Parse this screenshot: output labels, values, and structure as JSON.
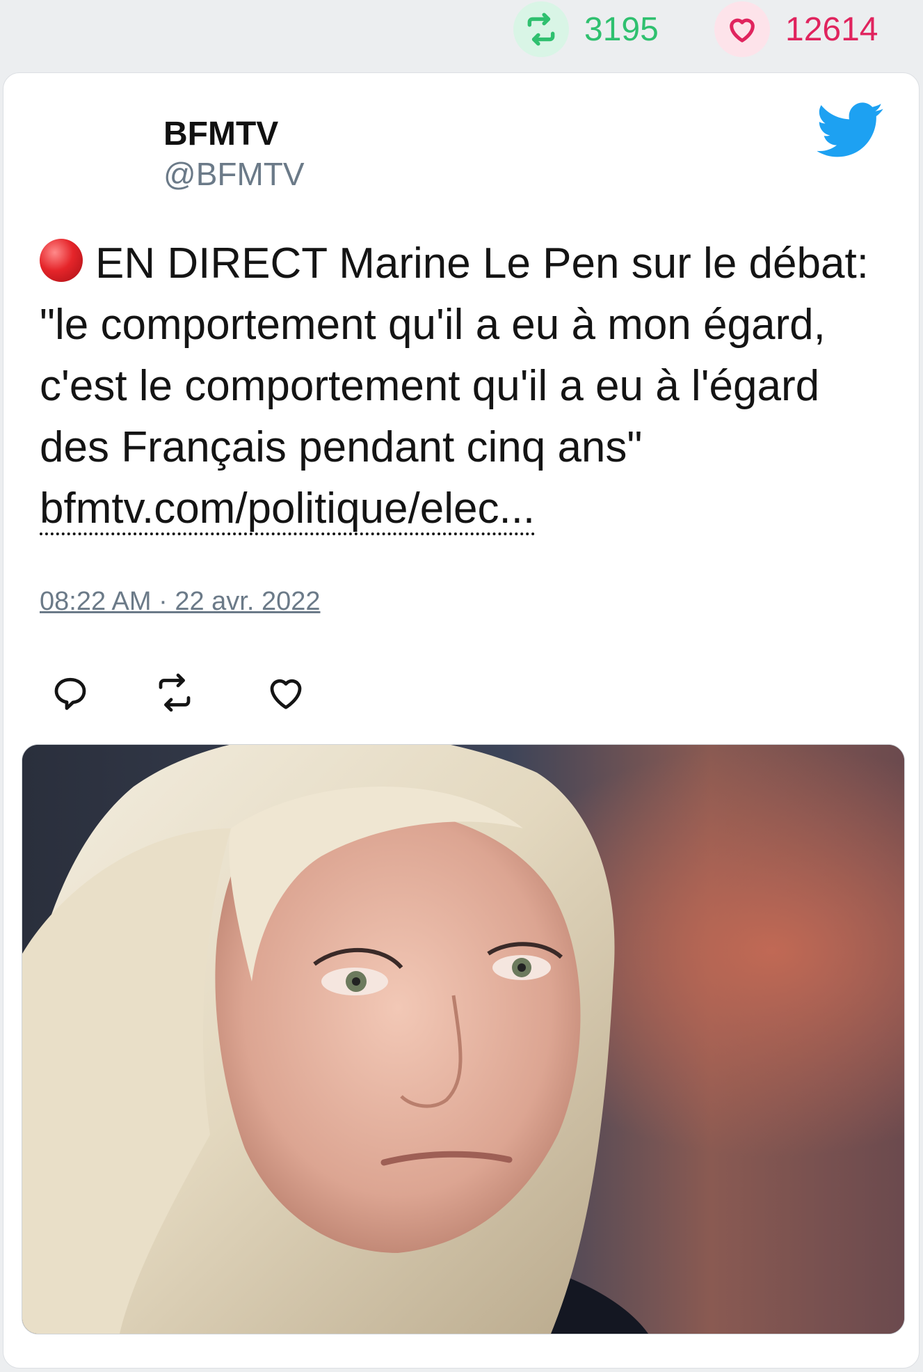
{
  "stats": {
    "retweets": "3195",
    "likes": "12614",
    "retweet_icon": "retweet-icon",
    "like_icon": "heart-icon"
  },
  "tweet": {
    "display_name": "BFMTV",
    "handle": "@BFMTV",
    "text": "EN DIRECT Marine Le Pen sur le débat: \"le comportement qu'il a eu à mon égard, c'est le comportement qu'il a eu à l'égard des Français pendant cinq ans\"",
    "link": "bfmtv.com/politique/elec...",
    "timestamp": "08:22 AM · 22 avr. 2022",
    "live_icon": "red-circle-icon",
    "brand_icon": "twitter-bird-icon"
  },
  "actions": [
    {
      "icon": "reply-icon"
    },
    {
      "icon": "retweet-icon"
    },
    {
      "icon": "heart-icon"
    }
  ],
  "colors": {
    "background": "#eceef0",
    "retweet_green": "#2fc06f",
    "like_red": "#e0245e",
    "twitter_blue": "#1da1f2",
    "muted_text": "#6b7a88"
  }
}
